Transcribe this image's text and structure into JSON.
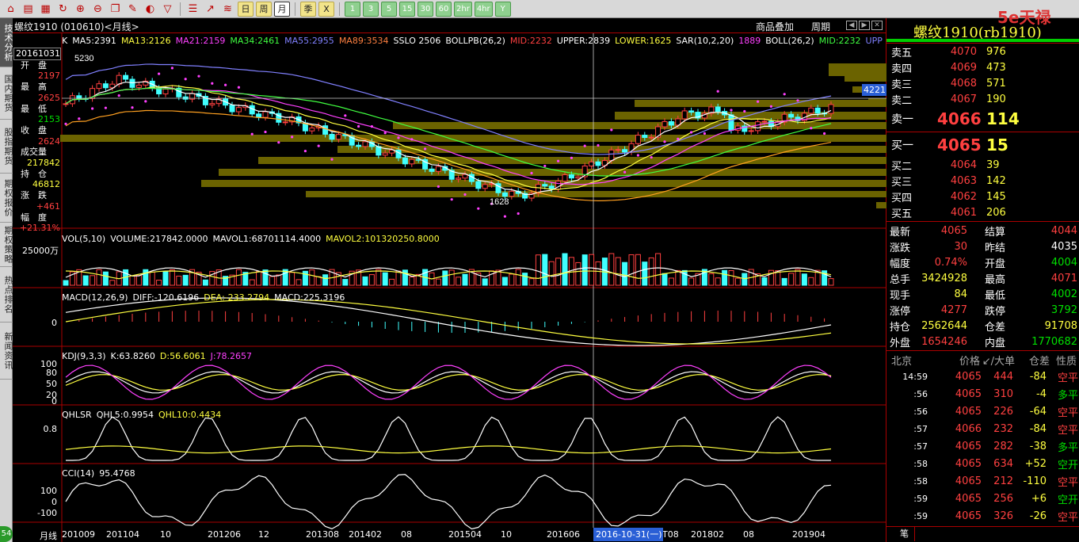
{
  "toolbar": {
    "icons": [
      "home-icon",
      "book-icon",
      "calendar-icon",
      "refresh-icon",
      "zoom-in-icon",
      "zoom-out-icon",
      "window-icon",
      "pen-icon",
      "paint-icon",
      "filter-icon",
      "list-icon",
      "chart-line-icon",
      "tick-icon"
    ],
    "periods": [
      "日",
      "周",
      "月"
    ],
    "active_period": "月",
    "extra": [
      "季",
      "X"
    ],
    "minutes": [
      "1",
      "3",
      "5",
      "15",
      "30",
      "60",
      "2hr",
      "4hr",
      "Y"
    ]
  },
  "sidebar": {
    "tabs": [
      "技术分析",
      "国内期货",
      "股指期货",
      "期权报价",
      "期权策略",
      "热点排名",
      "新闻资讯"
    ],
    "badge": "54"
  },
  "chart": {
    "title": "螺纹1910 (010610)<月线>",
    "links": [
      "商品叠加",
      "周期"
    ],
    "price_tag": "4221",
    "main_indicators": [
      {
        "t": "K",
        "c": "#fff"
      },
      {
        "t": "MA5:2391",
        "c": "#fff"
      },
      {
        "t": "MA13:2126",
        "c": "#ffff40"
      },
      {
        "t": "MA21:2159",
        "c": "#ff40ff"
      },
      {
        "t": "MA34:2461",
        "c": "#40ff40"
      },
      {
        "t": "MA55:2955",
        "c": "#8080ff"
      },
      {
        "t": "MA89:3534",
        "c": "#ff8040"
      },
      {
        "t": "SSLO 2506",
        "c": "#fff"
      },
      {
        "t": "BOLLPB(26,2)",
        "c": "#fff"
      },
      {
        "t": "MID:2232",
        "c": "#ff4040"
      },
      {
        "t": "UPPER:2839",
        "c": "#fff"
      },
      {
        "t": "LOWER:1625",
        "c": "#ffff40"
      },
      {
        "t": "SAR(10,2,20)",
        "c": "#fff"
      },
      {
        "t": "1889",
        "c": "#ff40ff"
      },
      {
        "t": "BOLL(26,2)",
        "c": "#fff"
      },
      {
        "t": "MID:2232",
        "c": "#40ff40"
      },
      {
        "t": "UPP",
        "c": "#8080ff"
      }
    ],
    "high_label": "5230",
    "low_label": "1628",
    "info": {
      "date": "20161031",
      "rows": [
        {
          "label": "开　盘",
          "value": "2197",
          "color": "red"
        },
        {
          "label": "最　高",
          "value": "2625",
          "color": "red"
        },
        {
          "label": "最　低",
          "value": "2153",
          "color": "grn"
        },
        {
          "label": "收　盘",
          "value": "2624",
          "color": "red"
        },
        {
          "label": "成交量",
          "value": "217842",
          "color": "yel"
        },
        {
          "label": "持　仓",
          "value": "46812",
          "color": "yel"
        },
        {
          "label": "涨　跌",
          "value": "+461",
          "color": "red"
        },
        {
          "label": "幅　度",
          "value": "+21.31%",
          "color": "red"
        }
      ]
    },
    "vol": {
      "label": "VOL(5,10)",
      "items": [
        {
          "t": "VOLUME:217842.0000",
          "c": "#fff"
        },
        {
          "t": "MAVOL1:68701114.4000",
          "c": "#fff"
        },
        {
          "t": "MAVOL2:101320250.8000",
          "c": "#ffff40"
        }
      ],
      "axis": "25000万"
    },
    "macd": {
      "label": "MACD(12,26,9)",
      "items": [
        {
          "t": "DIFF:-120.6196",
          "c": "#fff"
        },
        {
          "t": "DEA:-233.2794",
          "c": "#ffff40"
        },
        {
          "t": "MACD:225.3196",
          "c": "#fff"
        }
      ],
      "axis": "0"
    },
    "kdj": {
      "label": "KDJ(9,3,3)",
      "items": [
        {
          "t": "K:63.8260",
          "c": "#fff"
        },
        {
          "t": "D:56.6061",
          "c": "#ffff40"
        },
        {
          "t": "J:78.2657",
          "c": "#ff40ff"
        }
      ],
      "axis": [
        "100",
        "80",
        "50",
        "20",
        "0"
      ]
    },
    "qhlsr": {
      "label": "QHLSR",
      "items": [
        {
          "t": "QHL5:0.9954",
          "c": "#fff"
        },
        {
          "t": "QHL10:0.4434",
          "c": "#ffff40"
        }
      ],
      "axis": "0.8"
    },
    "cci": {
      "label": "CCI(14)",
      "items": [
        {
          "t": "95.4768",
          "c": "#fff"
        }
      ],
      "axis": [
        "100",
        "0",
        "-100"
      ]
    },
    "period_label": "月线",
    "xaxis": [
      "201009",
      "201104",
      "10",
      "201206",
      "12",
      "201308",
      "201402",
      "08",
      "201504",
      "10",
      "201606",
      "T08",
      "201802",
      "08",
      "201904"
    ],
    "cursor_date": "2016-10-31(一)"
  },
  "quote": {
    "name": "螺纹1910(rb1910)",
    "logo": "5e天禄",
    "asks": [
      {
        "l": "卖五",
        "p": "4070",
        "v": "976"
      },
      {
        "l": "卖四",
        "p": "4069",
        "v": "473"
      },
      {
        "l": "卖三",
        "p": "4068",
        "v": "571"
      },
      {
        "l": "卖二",
        "p": "4067",
        "v": "190"
      }
    ],
    "ask1": {
      "l": "卖一",
      "p": "4066",
      "v": "114"
    },
    "bid1": {
      "l": "买一",
      "p": "4065",
      "v": "15"
    },
    "bids": [
      {
        "l": "买二",
        "p": "4064",
        "v": "39"
      },
      {
        "l": "买三",
        "p": "4063",
        "v": "142"
      },
      {
        "l": "买四",
        "p": "4062",
        "v": "145"
      },
      {
        "l": "买五",
        "p": "4061",
        "v": "206"
      }
    ],
    "stats": [
      {
        "k1": "最新",
        "v1": "4065",
        "c1": "red",
        "k2": "结算",
        "v2": "4044",
        "c2": "red"
      },
      {
        "k1": "涨跌",
        "v1": "30",
        "c1": "red",
        "k2": "昨结",
        "v2": "4035",
        "c2": "wht"
      },
      {
        "k1": "幅度",
        "v1": "0.74%",
        "c1": "red",
        "k2": "开盘",
        "v2": "4004",
        "c2": "grn"
      },
      {
        "k1": "总手",
        "v1": "3424928",
        "c1": "yel",
        "k2": "最高",
        "v2": "4071",
        "c2": "red"
      },
      {
        "k1": "现手",
        "v1": "84",
        "c1": "yel",
        "k2": "最低",
        "v2": "4002",
        "c2": "grn"
      },
      {
        "k1": "涨停",
        "v1": "4277",
        "c1": "red",
        "k2": "跌停",
        "v2": "3792",
        "c2": "grn"
      },
      {
        "k1": "持仓",
        "v1": "2562644",
        "c1": "yel",
        "k2": "仓差",
        "v2": "91708",
        "c2": "yel"
      },
      {
        "k1": "外盘",
        "v1": "1654246",
        "c1": "red",
        "k2": "内盘",
        "v2": "1770682",
        "c2": "grn"
      }
    ],
    "tick_header": [
      "北京",
      "价格",
      "↙/大单",
      "仓差",
      "性质"
    ],
    "ticks": [
      {
        "t": "14:59",
        "p": "4065",
        "s": "444",
        "d": "-84",
        "x": "空平",
        "dc": "yel",
        "xc": "red"
      },
      {
        "t": ":56",
        "p": "4065",
        "s": "310",
        "d": "-4",
        "x": "多平",
        "dc": "yel",
        "xc": "grn"
      },
      {
        "t": ":56",
        "p": "4065",
        "s": "226",
        "d": "-64",
        "x": "空平",
        "dc": "yel",
        "xc": "red"
      },
      {
        "t": ":57",
        "p": "4066",
        "s": "232",
        "d": "-84",
        "x": "空平",
        "dc": "yel",
        "xc": "red"
      },
      {
        "t": ":57",
        "p": "4065",
        "s": "282",
        "d": "-38",
        "x": "多平",
        "dc": "yel",
        "xc": "grn"
      },
      {
        "t": ":58",
        "p": "4065",
        "s": "634",
        "d": "+52",
        "x": "空开",
        "dc": "yel",
        "xc": "grn"
      },
      {
        "t": ":58",
        "p": "4065",
        "s": "212",
        "d": "-110",
        "x": "空平",
        "dc": "yel",
        "xc": "red"
      },
      {
        "t": ":59",
        "p": "4065",
        "s": "256",
        "d": "+6",
        "x": "空开",
        "dc": "yel",
        "xc": "grn"
      },
      {
        "t": ":59",
        "p": "4065",
        "s": "326",
        "d": "-26",
        "x": "空平",
        "dc": "yel",
        "xc": "red"
      }
    ],
    "footer_tab": "笔"
  }
}
